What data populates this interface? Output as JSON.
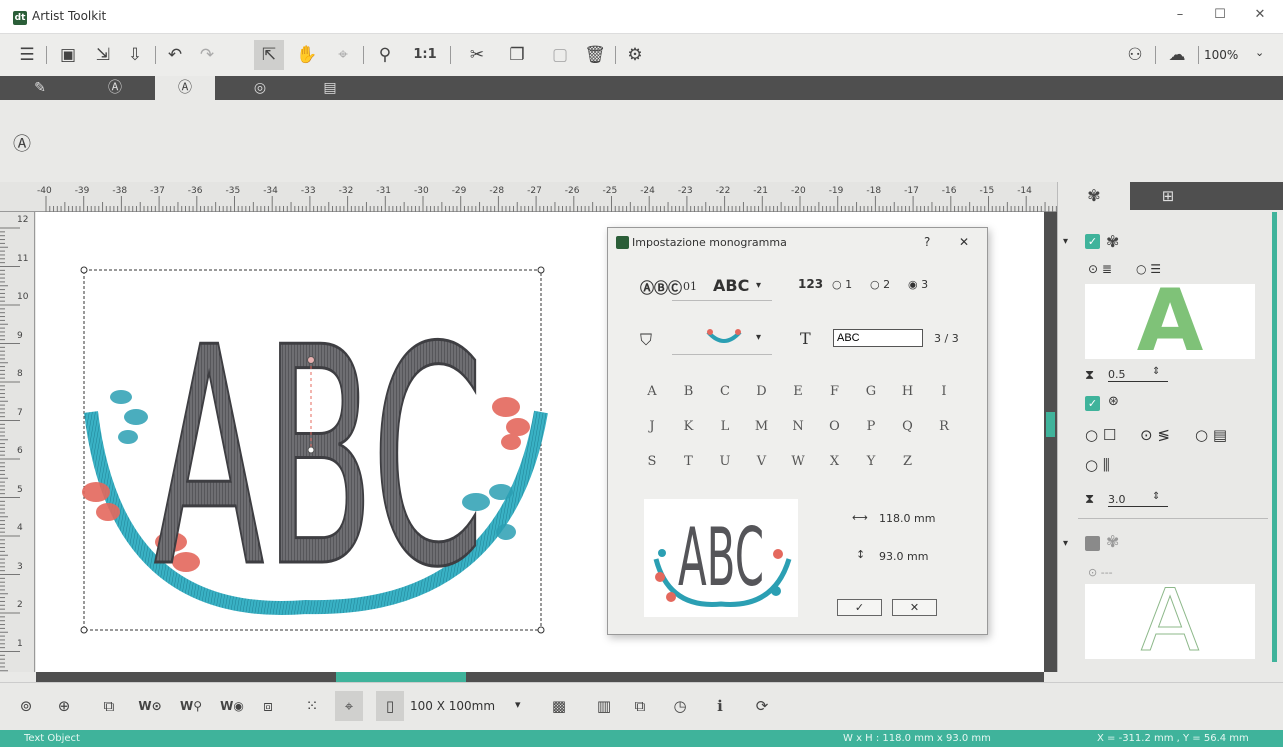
{
  "app": {
    "title": "Artist Toolkit"
  },
  "window": {
    "minimize": "–",
    "maximize": "☐",
    "close": "✕"
  },
  "toolbar": {
    "zoom": "100%"
  },
  "canvas_text": "ABC",
  "ruler": {
    "h_ticks": [
      "-40",
      "-39",
      "-38",
      "-37",
      "-36",
      "-35",
      "-34",
      "-33",
      "-32",
      "-31",
      "-30",
      "-29",
      "-28",
      "-27",
      "-26",
      "-25",
      "-24",
      "-23",
      "-22",
      "-21",
      "-20",
      "-19",
      "-18",
      "-17",
      "-16",
      "-15",
      "-14"
    ],
    "v_ticks": [
      "12",
      "11",
      "10",
      "9",
      "8",
      "7",
      "6",
      "5",
      "4",
      "3",
      "2",
      "1"
    ]
  },
  "dialog": {
    "title": "Impostazione monogramma",
    "help": "?",
    "close": "✕",
    "font_number": "01",
    "font_sample": "ABC",
    "count_options": [
      "1",
      "2",
      "3"
    ],
    "text_value": "ABC",
    "char_count": "3 / 3",
    "letters": [
      "A",
      "B",
      "C",
      "D",
      "E",
      "F",
      "G",
      "H",
      "I",
      "J",
      "K",
      "L",
      "M",
      "N",
      "O",
      "P",
      "Q",
      "R",
      "S",
      "T",
      "U",
      "V",
      "W",
      "X",
      "Y",
      "Z"
    ],
    "width": "118.0 mm",
    "height": "93.0 mm",
    "ok": "✓",
    "cancel": "✕"
  },
  "right_panel": {
    "density_1": "0.5",
    "density_2": "3.0",
    "none_label": "---",
    "preview_letter": "A"
  },
  "bottom": {
    "hoop_size": "100 X 100mm"
  },
  "status": {
    "left": "Text Object",
    "size": "W x H : 118.0 mm x 93.0 mm",
    "coords": "X = -311.2 mm , Y = 56.4 mm"
  },
  "colors": {
    "accent": "#3fb39b",
    "dark": "#4f4f4f",
    "thread_gray": "#555559",
    "thread_teal": "#2b9fb3",
    "thread_coral": "#e4685d"
  }
}
